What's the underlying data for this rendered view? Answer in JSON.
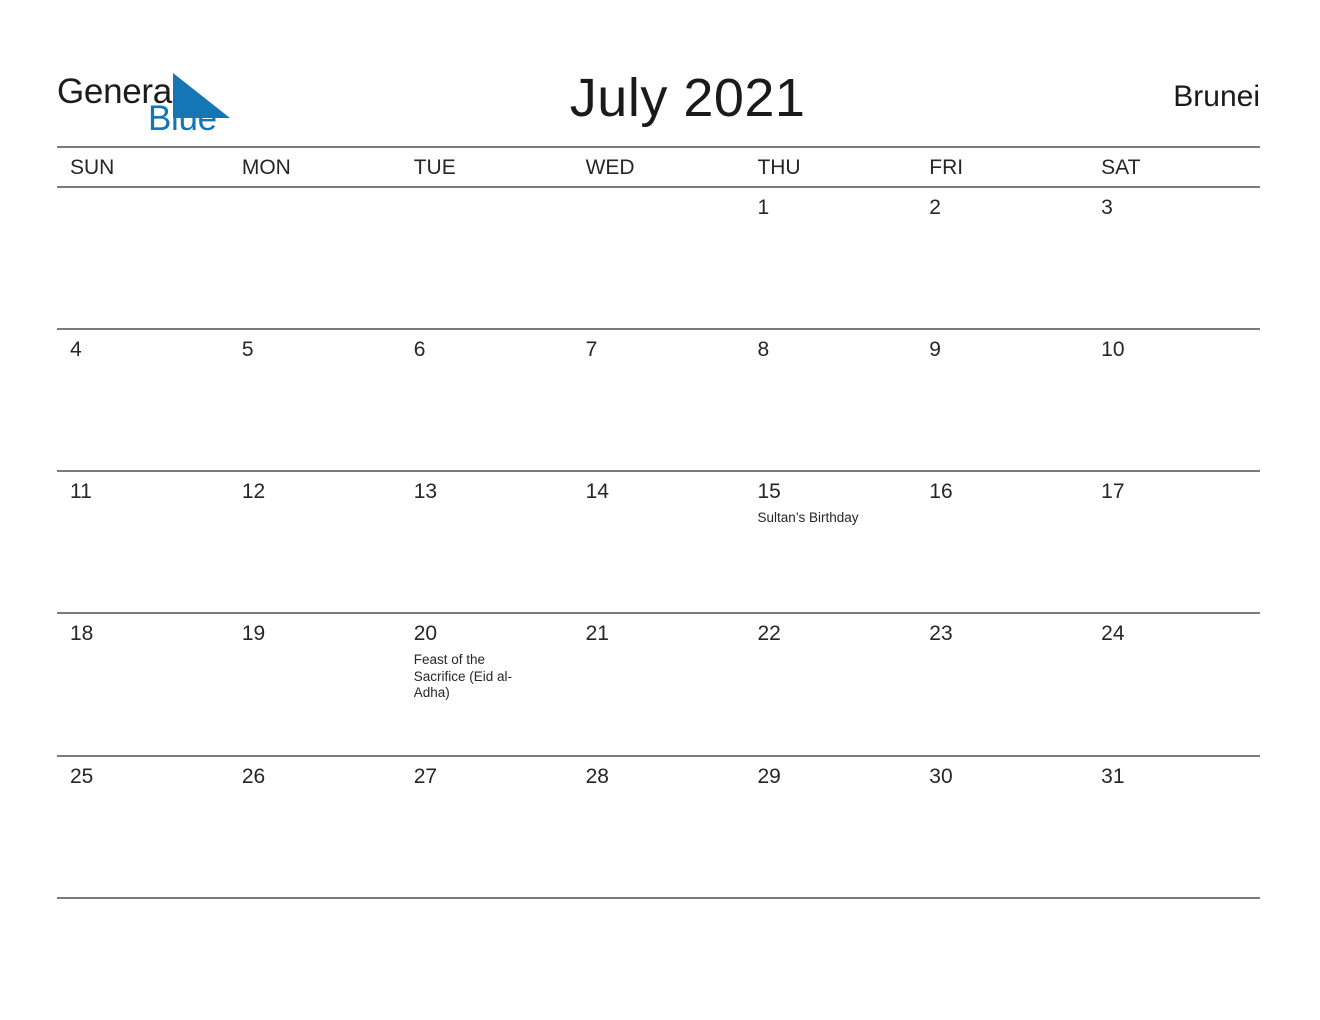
{
  "brand": {
    "word_one": "General",
    "word_two": "Blue",
    "triangle_icon": "blue-triangle-icon",
    "accent_color": "#1476b4",
    "text_color": "#1c1c1c"
  },
  "header": {
    "month_title": "July 2021",
    "country": "Brunei"
  },
  "calendar": {
    "weekdays": [
      "SUN",
      "MON",
      "TUE",
      "WED",
      "THU",
      "FRI",
      "SAT"
    ],
    "grid_line_color": "#7b7b7b",
    "weeks": [
      [
        {
          "day": "",
          "events": []
        },
        {
          "day": "",
          "events": []
        },
        {
          "day": "",
          "events": []
        },
        {
          "day": "",
          "events": []
        },
        {
          "day": "1",
          "events": []
        },
        {
          "day": "2",
          "events": []
        },
        {
          "day": "3",
          "events": []
        }
      ],
      [
        {
          "day": "4",
          "events": []
        },
        {
          "day": "5",
          "events": []
        },
        {
          "day": "6",
          "events": []
        },
        {
          "day": "7",
          "events": []
        },
        {
          "day": "8",
          "events": []
        },
        {
          "day": "9",
          "events": []
        },
        {
          "day": "10",
          "events": []
        }
      ],
      [
        {
          "day": "11",
          "events": []
        },
        {
          "day": "12",
          "events": []
        },
        {
          "day": "13",
          "events": []
        },
        {
          "day": "14",
          "events": []
        },
        {
          "day": "15",
          "events": [
            "Sultan’s Birthday"
          ]
        },
        {
          "day": "16",
          "events": []
        },
        {
          "day": "17",
          "events": []
        }
      ],
      [
        {
          "day": "18",
          "events": []
        },
        {
          "day": "19",
          "events": []
        },
        {
          "day": "20",
          "events": [
            "Feast of the Sacrifice (Eid al-Adha)"
          ]
        },
        {
          "day": "21",
          "events": []
        },
        {
          "day": "22",
          "events": []
        },
        {
          "day": "23",
          "events": []
        },
        {
          "day": "24",
          "events": []
        }
      ],
      [
        {
          "day": "25",
          "events": []
        },
        {
          "day": "26",
          "events": []
        },
        {
          "day": "27",
          "events": []
        },
        {
          "day": "28",
          "events": []
        },
        {
          "day": "29",
          "events": []
        },
        {
          "day": "30",
          "events": []
        },
        {
          "day": "31",
          "events": []
        }
      ]
    ]
  }
}
